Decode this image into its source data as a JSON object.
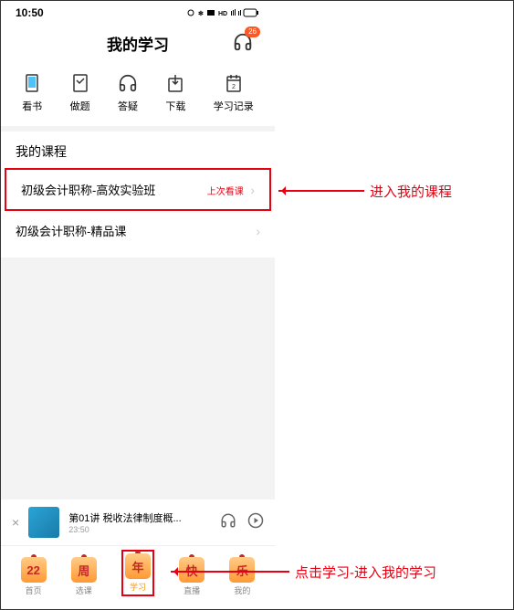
{
  "status": {
    "time": "10:50",
    "indicators": "⏰ ⁂ ⚡ ᯤ ⫴⫴ 📶 ⚡"
  },
  "header": {
    "title": "我的学习",
    "badge": "26"
  },
  "toolbar": {
    "items": [
      {
        "label": "看书"
      },
      {
        "label": "做题"
      },
      {
        "label": "答疑"
      },
      {
        "label": "下载"
      },
      {
        "label": "学习记录"
      }
    ]
  },
  "section": {
    "title": "我的课程"
  },
  "courses": [
    {
      "label": "初级会计职称-高效实验班",
      "tag": "上次看课"
    },
    {
      "label": "初级会计职称-精品课",
      "tag": ""
    }
  ],
  "player": {
    "title": "第01讲   税收法律制度概...",
    "time": "23:50"
  },
  "nav": {
    "items": [
      {
        "label": "首页",
        "char": "22"
      },
      {
        "label": "选课",
        "char": "周"
      },
      {
        "label": "学习",
        "char": "年"
      },
      {
        "label": "直播",
        "char": "快"
      },
      {
        "label": "我的",
        "char": "乐"
      }
    ]
  },
  "annotations": {
    "courses": "进入我的课程",
    "study": "点击学习-进入我的学习"
  }
}
